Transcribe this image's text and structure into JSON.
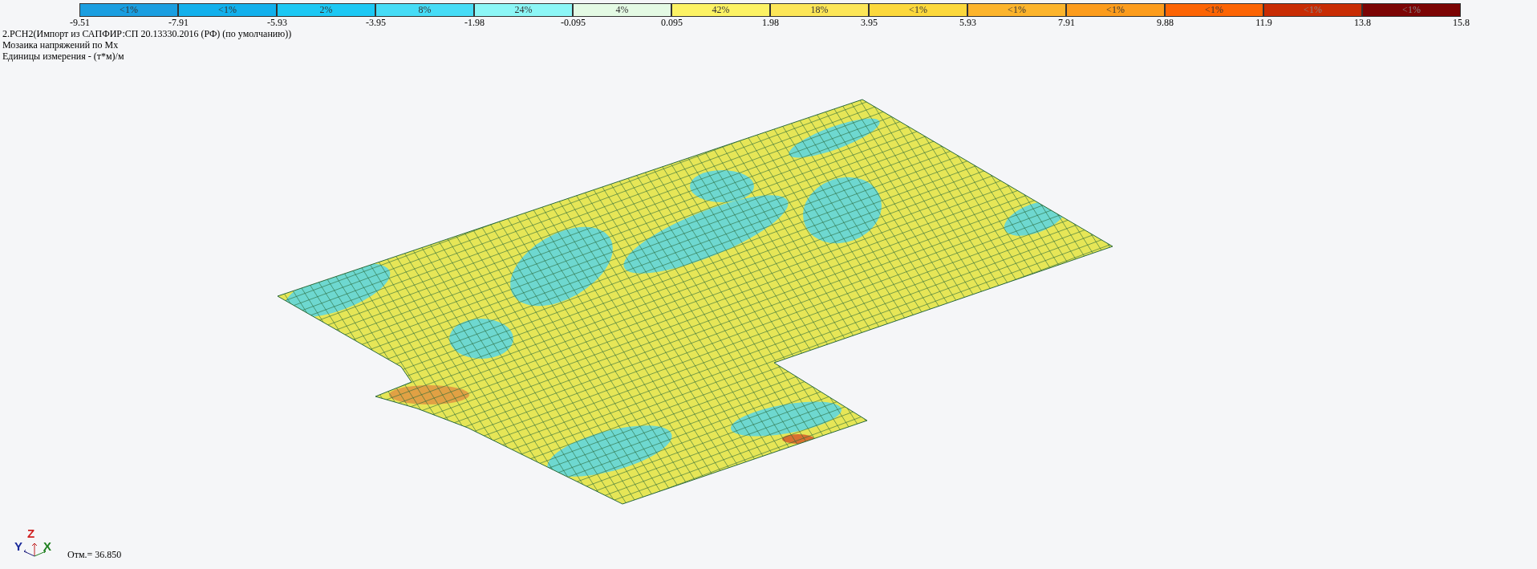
{
  "legend": {
    "cells": [
      {
        "label": "<1%",
        "color": "#1a9ee0"
      },
      {
        "label": "<1%",
        "color": "#12b0ec"
      },
      {
        "label": "2%",
        "color": "#1cc8f4"
      },
      {
        "label": "8%",
        "color": "#46dcf6"
      },
      {
        "label": "24%",
        "color": "#8cf6f6"
      },
      {
        "label": "4%",
        "color": "#e4fae4"
      },
      {
        "label": "42%",
        "color": "#fcf264"
      },
      {
        "label": "18%",
        "color": "#fce658"
      },
      {
        "label": "<1%",
        "color": "#fcd83c"
      },
      {
        "label": "<1%",
        "color": "#fcb42c"
      },
      {
        "label": "<1%",
        "color": "#fc9c1c"
      },
      {
        "label": "<1%",
        "color": "#fc6404"
      },
      {
        "label": "<1%",
        "color": "#c82c04"
      },
      {
        "label": "<1%",
        "color": "#7c0404"
      }
    ],
    "ticks": [
      "-9.51",
      "-7.91",
      "-5.93",
      "-3.95",
      "-1.98",
      "-0.095",
      "0.095",
      "1.98",
      "3.95",
      "5.93",
      "7.91",
      "9.88",
      "11.9",
      "13.8",
      "15.8"
    ]
  },
  "info_lines": [
    "2.РСН2(Импорт из САПФИР:СП 20.13330.2016 (РФ) (по умолчанию))",
    "Мозаика напряжений по Mx",
    "Единицы измерения - (т*м)/м"
  ],
  "axes": {
    "y": "Y",
    "z": "Z",
    "x": "X"
  },
  "elevation": "Отм.= 36.850"
}
